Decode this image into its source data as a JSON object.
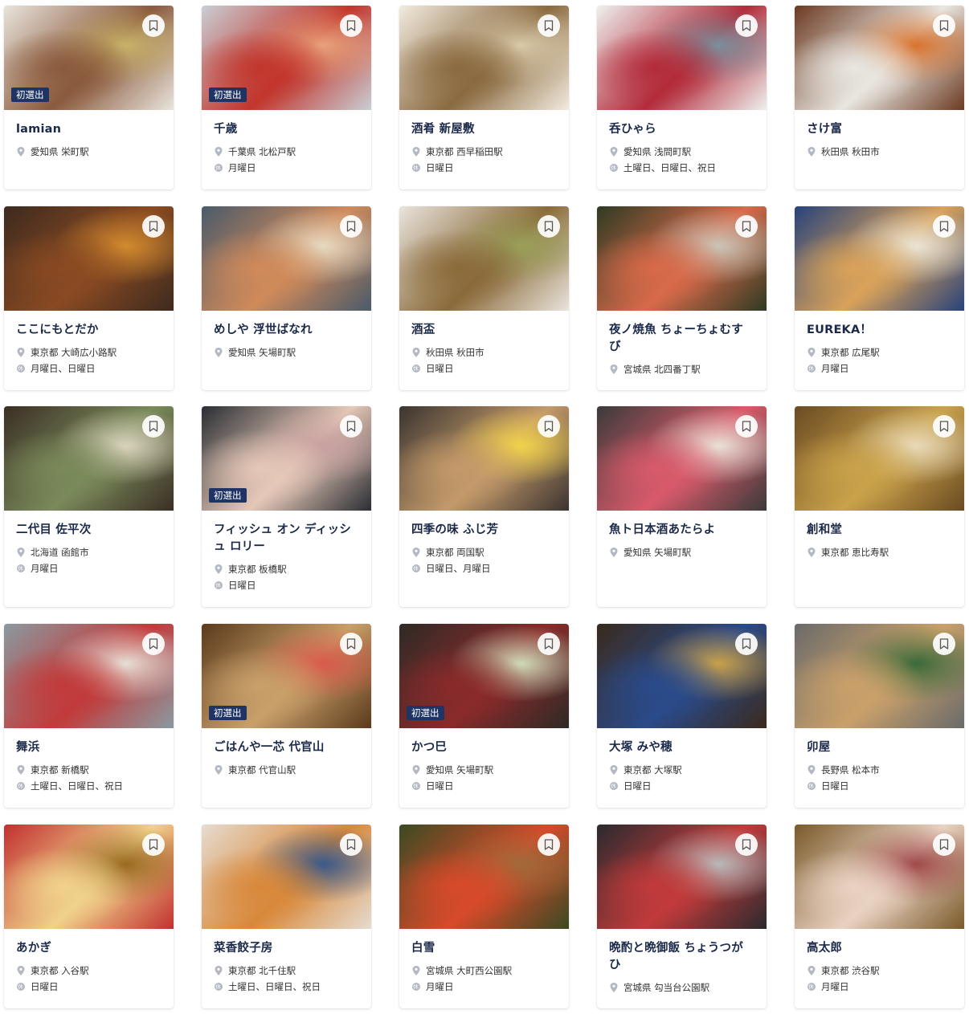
{
  "badge_label": "初選出",
  "icons": {
    "bookmark": "bookmark-icon",
    "location": "location-pin-icon",
    "holiday": "holiday-icon"
  },
  "holiday_glyph": "休",
  "colors": {
    "badge_bg": "#1f3464",
    "name_text": "#1c2a4a",
    "icon_gray": "#b3b8c2"
  },
  "restaurants": [
    {
      "name": "lamian",
      "location": "愛知県 栄町駅",
      "holiday": "",
      "badge": true,
      "photo": [
        "#e9e4dc",
        "#8a5a3c",
        "#c9b26a"
      ]
    },
    {
      "name": "千歳",
      "location": "千葉県 北松戸駅",
      "holiday": "月曜日",
      "badge": true,
      "photo": [
        "#c9ced4",
        "#c2352c",
        "#e8a27a"
      ]
    },
    {
      "name": "酒肴 新屋敷",
      "location": "東京都 西早稲田駅",
      "holiday": "日曜日",
      "badge": false,
      "photo": [
        "#f2ebdf",
        "#8a6a40",
        "#d8c9a8"
      ]
    },
    {
      "name": "呑ひゃら",
      "location": "愛知県 浅間町駅",
      "holiday": "土曜日、日曜日、祝日",
      "badge": false,
      "photo": [
        "#eef0ee",
        "#b32b3a",
        "#7a8f9c"
      ]
    },
    {
      "name": "さけ富",
      "location": "秋田県 秋田市",
      "holiday": "",
      "badge": false,
      "photo": [
        "#6b3a22",
        "#e9e6e0",
        "#d8732e"
      ]
    },
    {
      "name": "ここにもとだか",
      "location": "東京都 大崎広小路駅",
      "holiday": "月曜日、日曜日",
      "badge": false,
      "photo": [
        "#3d2a1e",
        "#8a4a22",
        "#d18a2e"
      ]
    },
    {
      "name": "めしや 浮世ばなれ",
      "location": "愛知県 矢場町駅",
      "holiday": "",
      "badge": false,
      "photo": [
        "#4a5a6a",
        "#d08a5a",
        "#e6d9c0"
      ]
    },
    {
      "name": "酒盃",
      "location": "秋田県 秋田市",
      "holiday": "日曜日",
      "badge": false,
      "photo": [
        "#e9e4dc",
        "#8a6a3a",
        "#9aa05a"
      ]
    },
    {
      "name": "夜ノ焼魚 ちょーちょむすび",
      "location": "宮城県 北四番丁駅",
      "holiday": "",
      "badge": false,
      "photo": [
        "#2e3a22",
        "#d86a4a",
        "#c9c4b6"
      ]
    },
    {
      "name": "EUREKA！",
      "location": "東京都 広尾駅",
      "holiday": "月曜日",
      "badge": false,
      "photo": [
        "#27427a",
        "#d9a25a",
        "#e9e4d6"
      ]
    },
    {
      "name": "二代目 佐平次",
      "location": "北海道 函館市",
      "holiday": "月曜日",
      "badge": false,
      "photo": [
        "#3a2e24",
        "#7a8a5a",
        "#d9d2bc"
      ]
    },
    {
      "name": "フィッシュ オン ディッシュ ロリー",
      "location": "東京都 板橋駅",
      "holiday": "日曜日",
      "badge": true,
      "photo": [
        "#2a2e33",
        "#e6c8b8",
        "#c7a0a0"
      ]
    },
    {
      "name": "四季の味 ふじ芳",
      "location": "東京都 両国駅",
      "holiday": "日曜日、月曜日",
      "badge": false,
      "photo": [
        "#3a3430",
        "#c49a6a",
        "#f0d24a"
      ]
    },
    {
      "name": "魚ト日本酒あたらよ",
      "location": "愛知県 矢場町駅",
      "holiday": "",
      "badge": false,
      "photo": [
        "#3a3a3a",
        "#d85a6a",
        "#e9e0d6"
      ]
    },
    {
      "name": "創和堂",
      "location": "東京都 恵比寿駅",
      "holiday": "",
      "badge": false,
      "photo": [
        "#6a4a22",
        "#c9a24a",
        "#e9d9b8"
      ]
    },
    {
      "name": "舞浜",
      "location": "東京都 新橋駅",
      "holiday": "土曜日、日曜日、祝日",
      "badge": false,
      "photo": [
        "#8a9aa0",
        "#c23a3a",
        "#e6dfd6"
      ]
    },
    {
      "name": "ごはんや一芯 代官山",
      "location": "東京都 代官山駅",
      "holiday": "",
      "badge": true,
      "photo": [
        "#5a3a1c",
        "#c9a06a",
        "#d85a4a"
      ]
    },
    {
      "name": "かつ巳",
      "location": "愛知県 矢場町駅",
      "holiday": "日曜日",
      "badge": true,
      "photo": [
        "#2e2a26",
        "#8a2a2a",
        "#cfd9b8"
      ]
    },
    {
      "name": "大塚 みや穂",
      "location": "東京都 大塚駅",
      "holiday": "日曜日",
      "badge": false,
      "photo": [
        "#3a2a1c",
        "#2a4a8a",
        "#c9a04a"
      ]
    },
    {
      "name": "卯屋",
      "location": "長野県 松本市",
      "holiday": "日曜日",
      "badge": false,
      "photo": [
        "#6a6a6a",
        "#c9a06a",
        "#3a6a3a"
      ]
    },
    {
      "name": "あかぎ",
      "location": "東京都 入谷駅",
      "holiday": "日曜日",
      "badge": false,
      "photo": [
        "#c23030",
        "#f0d28a",
        "#9a6a22"
      ]
    },
    {
      "name": "菜香餃子房",
      "location": "東京都 北千住駅",
      "holiday": "土曜日、日曜日、祝日",
      "badge": false,
      "photo": [
        "#e6dcd0",
        "#d8883a",
        "#3a5a8a"
      ]
    },
    {
      "name": "白雪",
      "location": "宮城県 大町西公園駅",
      "holiday": "月曜日",
      "badge": false,
      "photo": [
        "#3a4a22",
        "#d84a2a",
        "#a06a3a"
      ]
    },
    {
      "name": "晩酌と晩御飯 ちょうつがひ",
      "location": "宮城県 勾当台公園駅",
      "holiday": "",
      "badge": false,
      "photo": [
        "#2a2a2e",
        "#c23a3a",
        "#b8b8b8"
      ]
    },
    {
      "name": "高太郎",
      "location": "東京都 渋谷駅",
      "holiday": "月曜日",
      "badge": false,
      "photo": [
        "#7a5a2a",
        "#e9d2c2",
        "#a04a4a"
      ]
    }
  ]
}
